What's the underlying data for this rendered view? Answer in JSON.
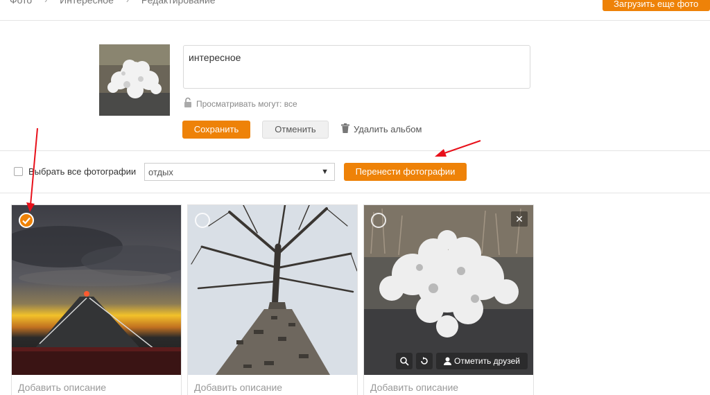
{
  "breadcrumb": {
    "items": [
      "Фото",
      "Интересное",
      "Редактирование"
    ],
    "sep": "›"
  },
  "header": {
    "upload_label": "Загрузить еще фото"
  },
  "album": {
    "title_value": "интересное",
    "privacy_label": "Просматривать могут: все",
    "save_label": "Сохранить",
    "cancel_label": "Отменить",
    "delete_label": "Удалить альбом"
  },
  "toolbar": {
    "select_all_label": "Выбрать все фотографии",
    "target_album": "отдых",
    "move_label": "Перенести фотографии"
  },
  "photos": [
    {
      "desc": "Добавить описание",
      "selected": true
    },
    {
      "desc": "Добавить описание",
      "selected": false
    },
    {
      "desc": "Добавить описание",
      "selected": false,
      "mark_friends_label": "Отметить друзей"
    }
  ],
  "colors": {
    "accent": "#ee8208",
    "annotation_arrow": "#e8101a"
  }
}
